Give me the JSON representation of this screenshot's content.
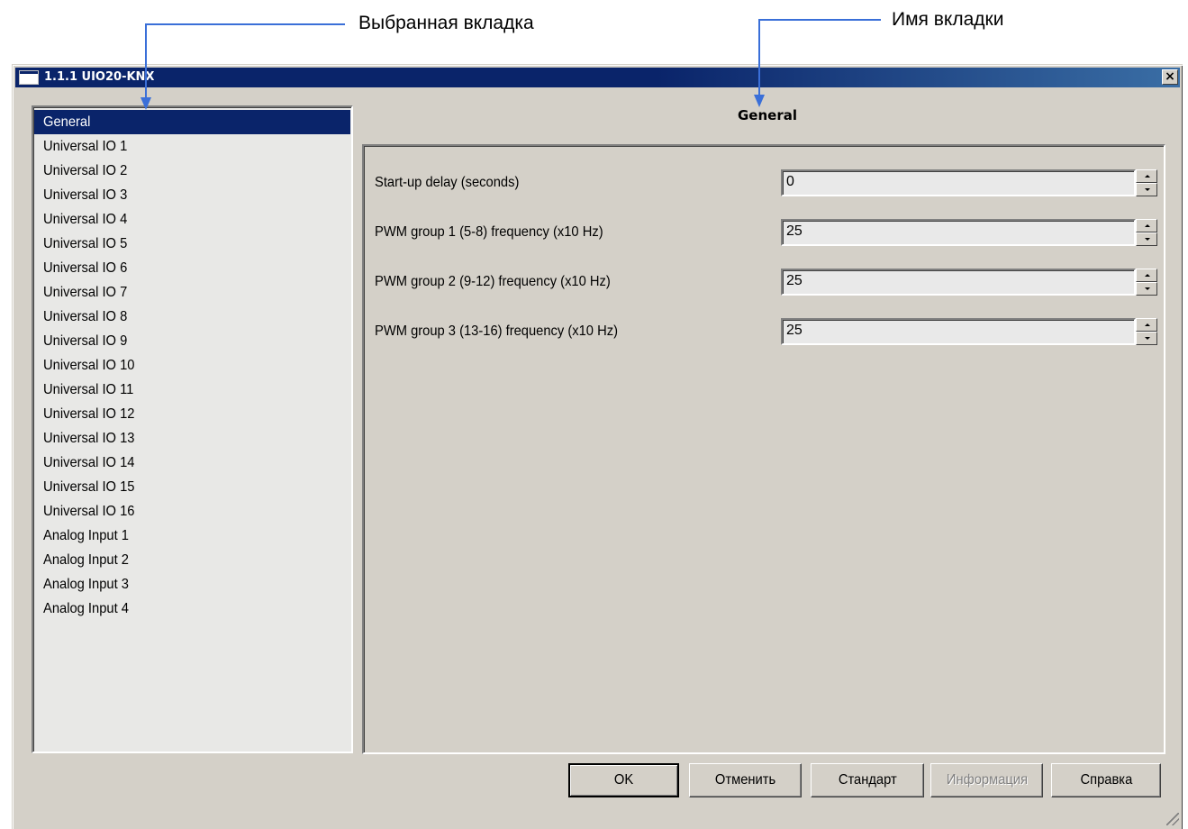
{
  "annotations": {
    "selected_tab_caption": "Выбранная вкладка",
    "tab_name_caption": "Имя вкладки",
    "arrow_color": "#3a6fd8"
  },
  "window": {
    "title": "1.1.1 UIO20-KNX",
    "close_label": "×"
  },
  "tabs": [
    {
      "label": "General",
      "selected": true
    },
    {
      "label": "Universal IO 1"
    },
    {
      "label": "Universal IO 2"
    },
    {
      "label": "Universal IO 3"
    },
    {
      "label": "Universal IO 4"
    },
    {
      "label": "Universal IO 5"
    },
    {
      "label": "Universal IO 6"
    },
    {
      "label": "Universal IO 7"
    },
    {
      "label": "Universal IO 8"
    },
    {
      "label": "Universal IO 9"
    },
    {
      "label": "Universal IO 10"
    },
    {
      "label": "Universal IO 11"
    },
    {
      "label": "Universal IO 12"
    },
    {
      "label": "Universal IO 13"
    },
    {
      "label": "Universal IO 14"
    },
    {
      "label": "Universal IO 15"
    },
    {
      "label": "Universal IO 16"
    },
    {
      "label": "Analog Input 1"
    },
    {
      "label": "Analog Input 2"
    },
    {
      "label": "Analog Input 3"
    },
    {
      "label": "Analog Input 4"
    }
  ],
  "page": {
    "title": "General",
    "params": [
      {
        "label": "Start-up delay (seconds)",
        "value": "0"
      },
      {
        "label": "PWM group 1 (5-8) frequency (x10 Hz)",
        "value": "25"
      },
      {
        "label": "PWM group 2 (9-12) frequency (x10 Hz)",
        "value": "25"
      },
      {
        "label": "PWM group 3 (13-16) frequency (x10 Hz)",
        "value": "25"
      }
    ]
  },
  "buttons": {
    "ok": "OK",
    "cancel": "Отменить",
    "default": "Стандарт",
    "info": "Информация",
    "help": "Справка"
  },
  "colors": {
    "titlebar": "#0a246a",
    "window_bg": "#d4d0c8",
    "selection": "#0a246a"
  }
}
